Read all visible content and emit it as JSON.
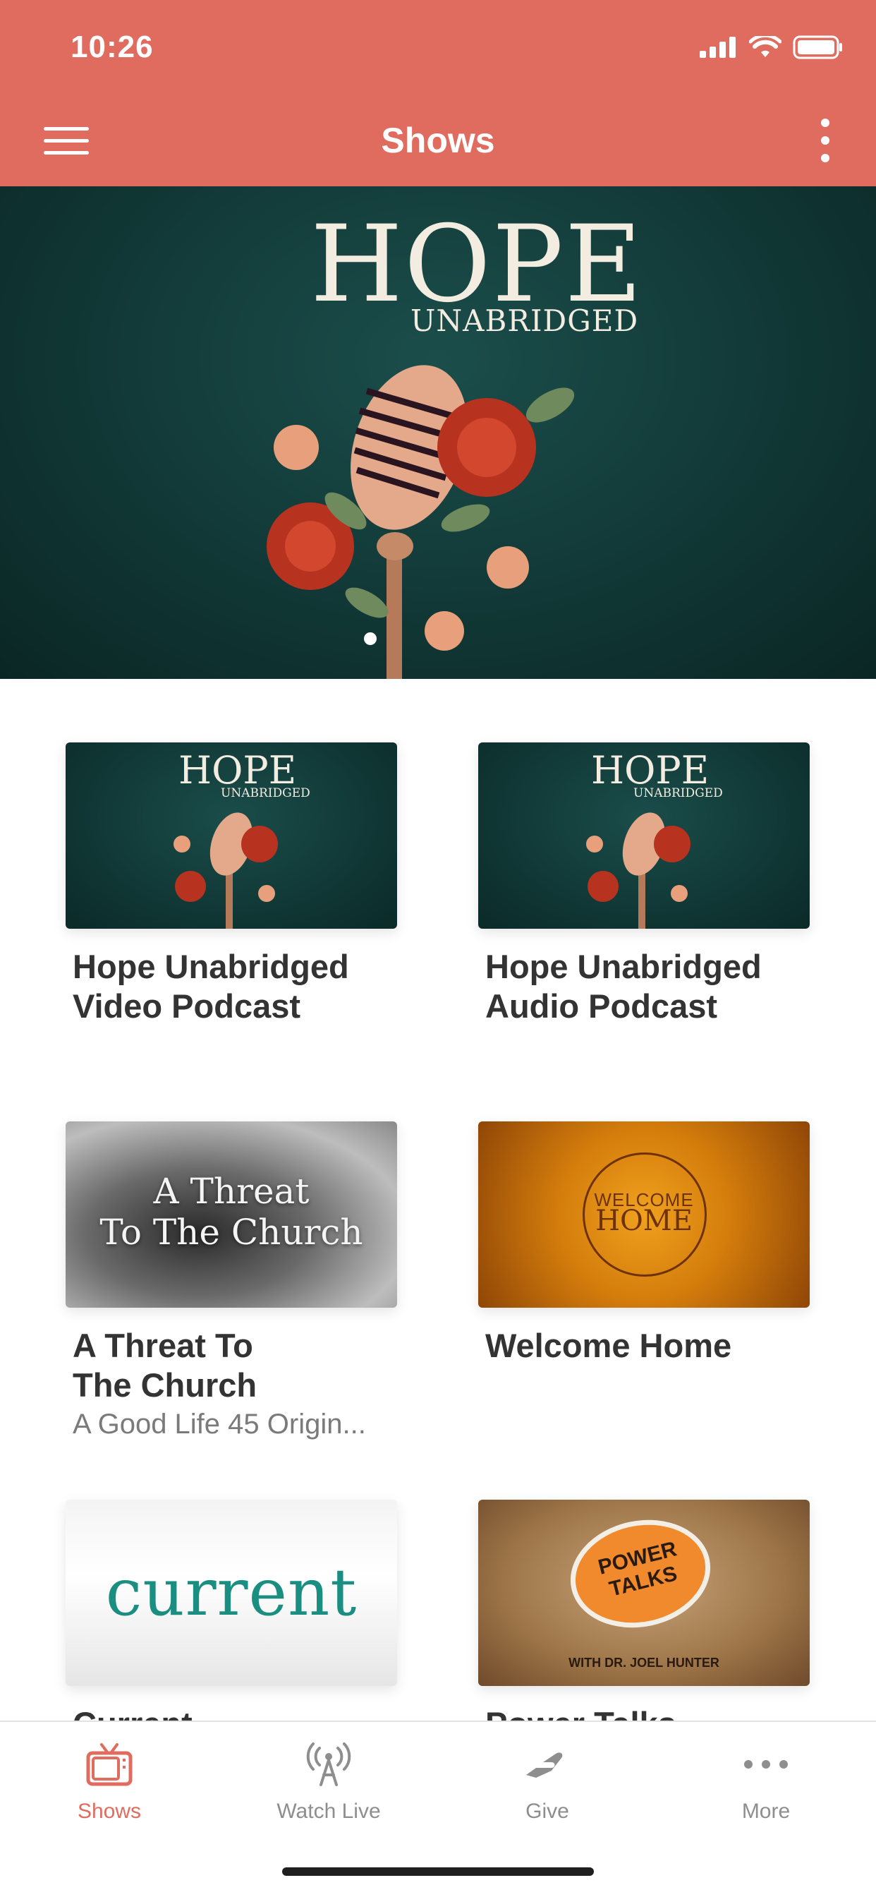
{
  "status_bar": {
    "time": "10:26"
  },
  "nav": {
    "title": "Shows"
  },
  "hero": {
    "logo_main": "HOPE",
    "logo_sub": "UNABRIDGED"
  },
  "shows": [
    {
      "title_line1": "Hope Unabridged",
      "title_line2": "Video Podcast",
      "subtitle": "",
      "thumb_main": "HOPE",
      "thumb_sub": "UNABRIDGED"
    },
    {
      "title_line1": "Hope Unabridged",
      "title_line2": "Audio Podcast",
      "subtitle": "",
      "thumb_main": "HOPE",
      "thumb_sub": "UNABRIDGED"
    },
    {
      "title_line1": "A Threat To",
      "title_line2": "The Church",
      "subtitle": "A Good Life 45 Origin...",
      "thumb_line1": "A Threat",
      "thumb_line2": "To The Church"
    },
    {
      "title_line1": "Welcome Home",
      "title_line2": "",
      "subtitle": "",
      "thumb_line1": "WELCOME",
      "thumb_line2": "HOME"
    },
    {
      "title_line1": "Current",
      "title_line2": "",
      "subtitle": "",
      "thumb_text": "current"
    },
    {
      "title_line1": "Power Talks",
      "title_line2": "",
      "subtitle": "",
      "thumb_line1": "POWER",
      "thumb_line2": "TALKS",
      "thumb_sub": "WITH DR. JOEL HUNTER"
    }
  ],
  "tabs": [
    {
      "label": "Shows",
      "icon": "tv-icon",
      "active": true
    },
    {
      "label": "Watch Live",
      "icon": "broadcast-icon",
      "active": false
    },
    {
      "label": "Give",
      "icon": "give-hand-icon",
      "active": false
    },
    {
      "label": "More",
      "icon": "more-dots-icon",
      "active": false
    }
  ],
  "colors": {
    "accent": "#e06c5f",
    "hero_bg": "#123a38",
    "tab_inactive": "#8e8e8e"
  }
}
